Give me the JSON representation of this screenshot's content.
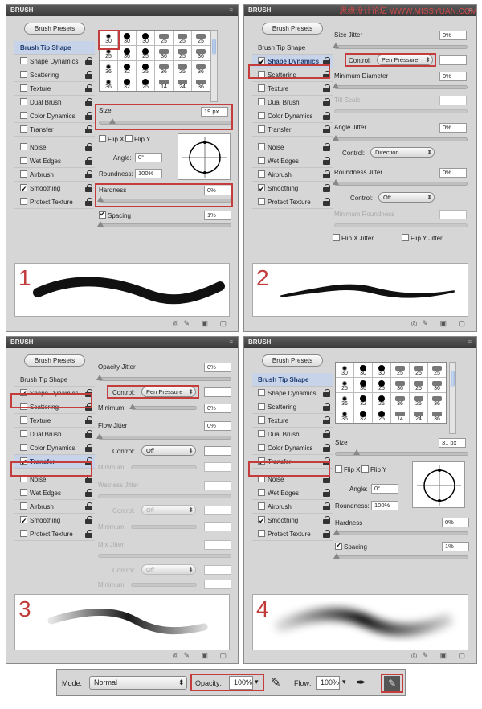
{
  "watermark": "思缘设计论坛 WWW.MISSYUAN.COM",
  "panel_title": "BRUSH",
  "menu_icon": "≡",
  "presets_label": "Brush Presets",
  "side_items": [
    "Brush Tip Shape",
    "Shape Dynamics",
    "Scattering",
    "Texture",
    "Dual Brush",
    "Color Dynamics",
    "Transfer",
    "Noise",
    "Wet Edges",
    "Airbrush",
    "Smoothing",
    "Protect Texture"
  ],
  "footer_icons": "◎✎ ▣ ▢",
  "tips_row": [
    "30",
    "30",
    "30",
    "25",
    "25",
    "25"
  ],
  "tips": [
    "30",
    "30",
    "30",
    "25",
    "25",
    "25",
    "25",
    "36",
    "25",
    "36",
    "25",
    "36",
    "36",
    "32",
    "25",
    "36",
    "25",
    "36",
    "36",
    "32",
    "25",
    "14",
    "24",
    "36"
  ],
  "p1": {
    "number": "1",
    "size_label": "Size",
    "size": "19 px",
    "flipx": "Flip X",
    "flipy": "Flip Y",
    "angle_label": "Angle:",
    "angle": "0°",
    "round_label": "Roundness:",
    "roundness": "100%",
    "hardness_label": "Hardness",
    "hardness": "0%",
    "spacing_label": "Spacing",
    "spacing": "1%"
  },
  "p2": {
    "number": "2",
    "size_jitter": "Size Jitter",
    "sj": "0%",
    "control": "Control:",
    "control_val": "Pen Pressure",
    "min_diam": "Minimum Diameter",
    "md": "0%",
    "tilt": "Tilt Scale",
    "angle_jitter": "Angle Jitter",
    "aj": "0%",
    "control2": "Direction",
    "round_jitter": "Roundness Jitter",
    "rj": "0%",
    "control3": "Off",
    "min_round": "Minimum Roundness",
    "flipx": "Flip X Jitter",
    "flipy": "Flip Y Jitter"
  },
  "p3": {
    "number": "3",
    "opacity_jitter": "Opacity Jitter",
    "oj": "0%",
    "control": "Control:",
    "control_val": "Pen Pressure",
    "minimum": "Minimum",
    "mn": "0%",
    "flow_jitter": "Flow Jitter",
    "fj": "0%",
    "control2": "Off",
    "wetness": "Wetness Jitter",
    "mix": "Mix Jitter"
  },
  "p4": {
    "number": "4",
    "size_label": "Size",
    "size": "31 px",
    "flipx": "Flip X",
    "flipy": "Flip Y",
    "angle_label": "Angle:",
    "angle": "0°",
    "round_label": "Roundness:",
    "roundness": "100%",
    "hardness_label": "Hardness",
    "hardness": "0%",
    "spacing_label": "Spacing",
    "spacing": "1%"
  },
  "toolbar": {
    "mode_label": "Mode:",
    "mode": "Normal",
    "opacity_label": "Opacity:",
    "opacity": "100%",
    "flow_label": "Flow:",
    "flow": "100%"
  }
}
